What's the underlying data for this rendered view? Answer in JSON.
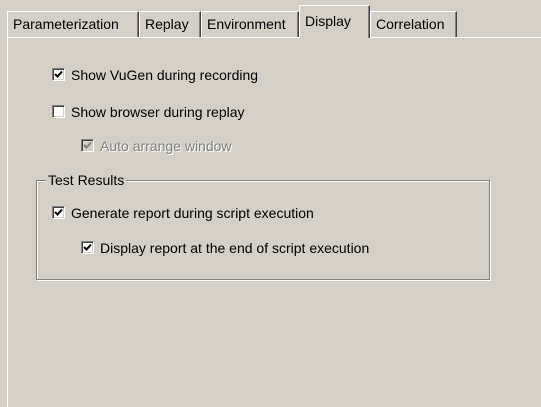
{
  "tabs": [
    {
      "label": "Parameterization"
    },
    {
      "label": "Replay"
    },
    {
      "label": "Environment"
    },
    {
      "label": "Display"
    },
    {
      "label": "Correlation"
    }
  ],
  "options": {
    "show_vugen": {
      "label": "Show VuGen during recording",
      "checked": true
    },
    "show_browser": {
      "label": "Show browser during replay",
      "checked": false
    },
    "auto_arrange": {
      "label": "Auto arrange window",
      "checked": true,
      "disabled": true
    }
  },
  "test_results": {
    "title": "Test Results",
    "generate_report": {
      "label": "Generate report during script execution",
      "checked": true
    },
    "display_report": {
      "label": "Display report at the end of script execution",
      "checked": true
    }
  }
}
